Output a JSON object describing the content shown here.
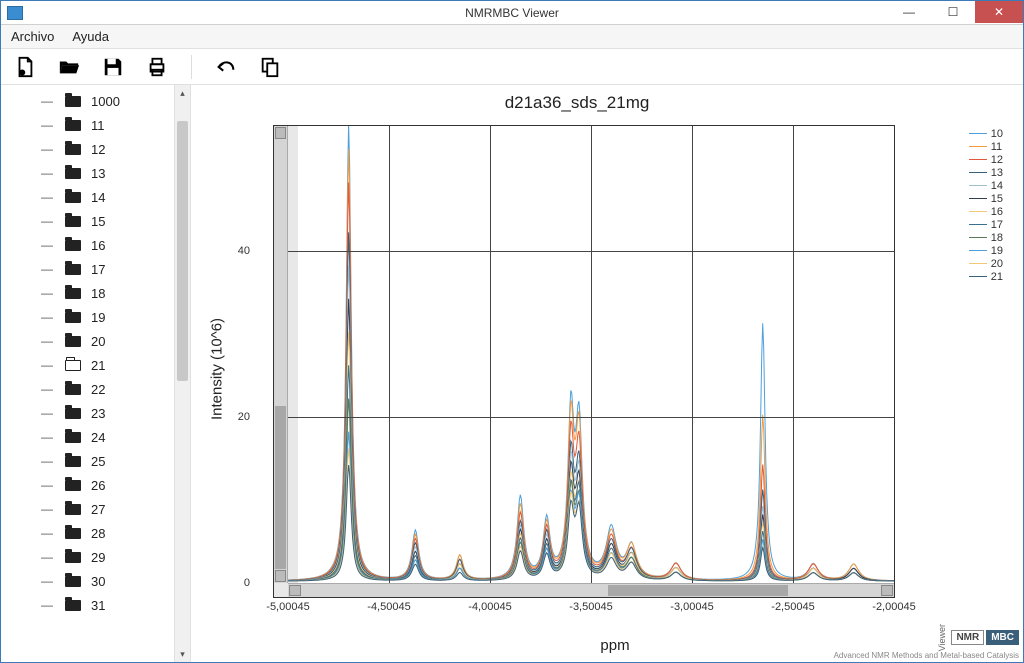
{
  "window": {
    "title": "NMRMBC Viewer"
  },
  "menu": {
    "file": "Archivo",
    "help": "Ayuda"
  },
  "tree": {
    "items": [
      {
        "label": "1000",
        "open": false
      },
      {
        "label": "11",
        "open": false
      },
      {
        "label": "12",
        "open": false
      },
      {
        "label": "13",
        "open": false
      },
      {
        "label": "14",
        "open": false
      },
      {
        "label": "15",
        "open": false
      },
      {
        "label": "16",
        "open": false
      },
      {
        "label": "17",
        "open": false
      },
      {
        "label": "18",
        "open": false
      },
      {
        "label": "19",
        "open": false
      },
      {
        "label": "20",
        "open": false
      },
      {
        "label": "21",
        "open": true
      },
      {
        "label": "22",
        "open": false
      },
      {
        "label": "23",
        "open": false
      },
      {
        "label": "24",
        "open": false
      },
      {
        "label": "25",
        "open": false
      },
      {
        "label": "26",
        "open": false
      },
      {
        "label": "27",
        "open": false
      },
      {
        "label": "28",
        "open": false
      },
      {
        "label": "29",
        "open": false
      },
      {
        "label": "30",
        "open": false
      },
      {
        "label": "31",
        "open": false
      }
    ]
  },
  "chart_data": {
    "type": "line",
    "title": "d21a36_sds_21mg",
    "xlabel": "ppm",
    "ylabel": "Intensity (10^6)",
    "xlim": [
      -5.00045,
      -2.00045
    ],
    "ylim": [
      0,
      55
    ],
    "xticks": [
      "-5,00045",
      "-4,50045",
      "-4,00045",
      "-3,50045",
      "-3,00045",
      "-2,50045",
      "-2,00045"
    ],
    "yticks": [
      "0",
      "20",
      "40"
    ],
    "series": [
      {
        "name": "10",
        "color": "#4f9fdc"
      },
      {
        "name": "11",
        "color": "#f29b3e"
      },
      {
        "name": "12",
        "color": "#e05a3a"
      },
      {
        "name": "13",
        "color": "#3a5f7a"
      },
      {
        "name": "14",
        "color": "#9fbfd0"
      },
      {
        "name": "15",
        "color": "#2f3f4f"
      },
      {
        "name": "16",
        "color": "#f2c77a"
      },
      {
        "name": "17",
        "color": "#3a6f8f"
      },
      {
        "name": "18",
        "color": "#5a7a5a"
      },
      {
        "name": "19",
        "color": "#4f9fdc"
      },
      {
        "name": "20",
        "color": "#f2c77a"
      },
      {
        "name": "21",
        "color": "#3a5f7a"
      }
    ],
    "peaks": [
      {
        "x": -4.7,
        "heights": [
          55,
          52,
          48,
          42,
          38,
          34,
          30,
          26,
          22,
          18,
          16,
          14
        ],
        "width": 0.015
      },
      {
        "x": -4.37,
        "heights": [
          6,
          5.5,
          5,
          4.5,
          4,
          3.5,
          3,
          3,
          2.5,
          2.5,
          2,
          2
        ],
        "width": 0.02
      },
      {
        "x": -4.15,
        "heights": [
          3,
          3,
          2.5,
          2.5,
          2,
          2,
          2,
          1.5,
          1.5,
          1.5,
          1,
          1
        ],
        "width": 0.02
      },
      {
        "x": -3.85,
        "heights": [
          10,
          9,
          8,
          7,
          6.5,
          6,
          5.5,
          5,
          4.5,
          4,
          4,
          3.5
        ],
        "width": 0.02
      },
      {
        "x": -3.72,
        "heights": [
          7,
          6.5,
          6,
          5.5,
          5,
          4.5,
          4,
          4,
          3.5,
          3.5,
          3,
          3
        ],
        "width": 0.02
      },
      {
        "x": -3.6,
        "heights": [
          19,
          18,
          16,
          14,
          13,
          12,
          11,
          10,
          10,
          9,
          9,
          8
        ],
        "width": 0.018
      },
      {
        "x": -3.56,
        "heights": [
          18,
          17,
          15,
          13,
          12,
          11,
          10,
          10,
          9,
          9,
          8,
          8
        ],
        "width": 0.02
      },
      {
        "x": -3.4,
        "heights": [
          6,
          5.5,
          5,
          4.5,
          4,
          4,
          3.5,
          3.5,
          3,
          3,
          3,
          2.5
        ],
        "width": 0.03
      },
      {
        "x": -3.3,
        "heights": [
          4,
          4,
          3.5,
          3.5,
          3,
          3,
          3,
          2.5,
          2.5,
          2,
          2,
          2
        ],
        "width": 0.03
      },
      {
        "x": -3.08,
        "heights": [
          2,
          2,
          2,
          1.5,
          1.5,
          1.5,
          1.5,
          1,
          1,
          1,
          1,
          1
        ],
        "width": 0.03
      },
      {
        "x": -2.65,
        "heights": [
          31,
          20,
          14,
          11,
          9,
          8,
          7,
          6,
          5,
          5,
          4,
          4
        ],
        "width": 0.014
      },
      {
        "x": -2.4,
        "heights": [
          2,
          2,
          2,
          1.5,
          1.5,
          1.5,
          1.5,
          1,
          1,
          1,
          1,
          1
        ],
        "width": 0.03
      },
      {
        "x": -2.2,
        "heights": [
          2,
          2,
          1.5,
          1.5,
          1.5,
          1.5,
          1,
          1,
          1,
          1,
          1,
          1
        ],
        "width": 0.03
      }
    ]
  },
  "logo": {
    "viewer": "Viewer",
    "nmr": "NMR",
    "mbc": "MBC",
    "tag": "Advanced NMR Methods and Metal-based Catalysis"
  }
}
